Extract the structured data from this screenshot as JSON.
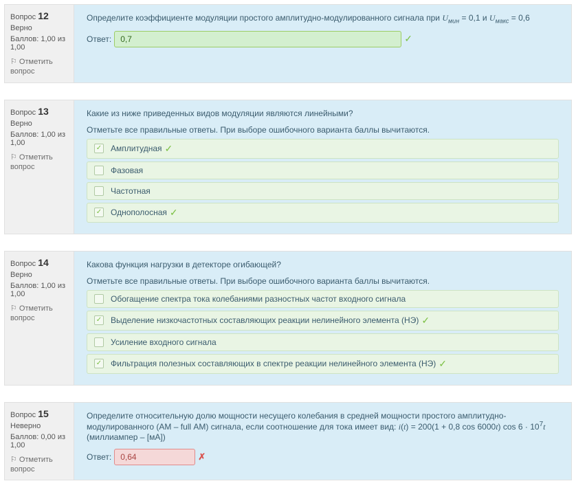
{
  "labels": {
    "question_word": "Вопрос",
    "correct_state": "Верно",
    "incorrect_state": "Неверно",
    "flag": "Отметить вопрос",
    "answer": "Ответ:",
    "select_all_instruct": "Отметьте все правильные ответы. При выборе ошибочного варианта баллы вычитаются."
  },
  "questions": [
    {
      "number": "12",
      "state_key": "correct_state",
      "grade": "Баллов: 1,00 из 1,00",
      "type": "text",
      "qtext_prefix": "Определите коэффициенте модуляции простого амплитудно-модулированного сигнала при ",
      "math_html": "<span class='math-i'>U</span><sub class='math-sub'>мин</sub> = 0,1 и <span class='math-i'>U</span><sub class='math-sub'>макс</sub> = 0,6",
      "answer_value": "0,7",
      "answer_correct": true
    },
    {
      "number": "13",
      "state_key": "correct_state",
      "grade": "Баллов: 1,00 из 1,00",
      "type": "multi",
      "qtext": "Какие из ниже приведенных видов модуляции являются линейными?",
      "options": [
        {
          "label": "Амплитудная",
          "checked": true,
          "tick": true
        },
        {
          "label": "Фазовая",
          "checked": false,
          "tick": false
        },
        {
          "label": "Частотная",
          "checked": false,
          "tick": false
        },
        {
          "label": "Однополосная",
          "checked": true,
          "tick": true
        }
      ]
    },
    {
      "number": "14",
      "state_key": "correct_state",
      "grade": "Баллов: 1,00 из 1,00",
      "type": "multi",
      "qtext": "Какова функция нагрузки в детекторе огибающей?",
      "options": [
        {
          "label": "Обогащение спектра тока колебаниями разностных частот входного сигнала",
          "checked": false,
          "tick": false
        },
        {
          "label": "Выделение низкочастотных составляющих реакции нелинейного элемента (НЭ)",
          "checked": true,
          "tick": true
        },
        {
          "label": "Усиление входного сигнала",
          "checked": false,
          "tick": false
        },
        {
          "label": "Фильтрация полезных составляющих в спектре реакции нелинейного элемента (НЭ)",
          "checked": true,
          "tick": true
        }
      ]
    },
    {
      "number": "15",
      "state_key": "incorrect_state",
      "grade": "Баллов: 0,00 из 1,00",
      "type": "text",
      "qtext_prefix": "Определите относительную долю мощности несущего колебания в средней мощности простого амплитудно-модулированного (АМ – full АМ) сигнала, если соотношение для тока имеет вид: ",
      "math_html": "<span class='math-i'>i</span>(<span class='math-i'>t</span>) = 200(1 + 0,8 cos 6000<span class='math-i'>t</span>) cos 6 · 10<sup>7</sup><span class='math-i'>t</span> (миллиампер – [мА])",
      "answer_value": "0,64",
      "answer_correct": false
    }
  ]
}
